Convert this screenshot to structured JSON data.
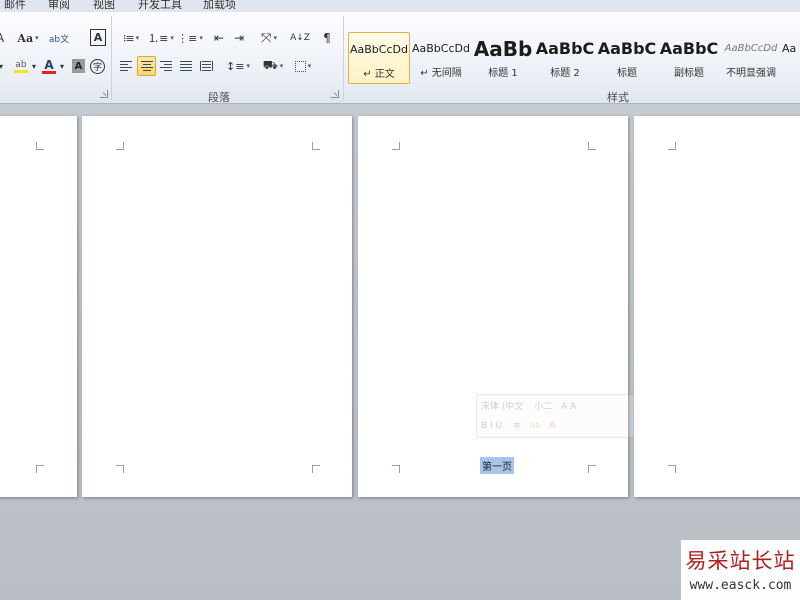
{
  "tabs": [
    "邮件",
    "审阅",
    "视图",
    "开发工具",
    "加载项"
  ],
  "font_group": {
    "change_case_label": "Aa",
    "phonetic_glyph": "ab文",
    "char_border_glyph": "A",
    "highlight_glyph": "ab",
    "font_color_glyph": "A",
    "char_shading_glyph": "A",
    "enclose_glyph": "字"
  },
  "paragraph_group": {
    "label": "段落",
    "sort_glyph": "A↓Z"
  },
  "styles_group": {
    "label": "样式",
    "items": [
      {
        "sample": "AaBbCcDd",
        "name": "正文",
        "selected": true
      },
      {
        "sample": "AaBbCcDd",
        "name": "无间隔",
        "selected": false
      },
      {
        "sample": "AaBb",
        "name": "标题 1",
        "selected": false
      },
      {
        "sample": "AaBbC",
        "name": "标题 2",
        "selected": false
      },
      {
        "sample": "AaBbC",
        "name": "标题",
        "selected": false
      },
      {
        "sample": "AaBbC",
        "name": "副标题",
        "selected": false
      },
      {
        "sample": "AaBbCcDd",
        "name": "不明显强调",
        "selected": false
      },
      {
        "sample": "Aa",
        "name": "",
        "selected": false
      }
    ]
  },
  "document": {
    "selected_text": "第一页"
  },
  "mini_toolbar": {
    "font": "宋体 (中文",
    "size": "小二",
    "format_glyphs": "B  I  U"
  },
  "watermark": {
    "title": "易采站长站",
    "url": "www.easck.com"
  },
  "colors": {
    "highlight": "#f3e415",
    "font_color": "#e0231b",
    "selection": "#a7c4ea",
    "brand_red": "#b11f1f"
  }
}
